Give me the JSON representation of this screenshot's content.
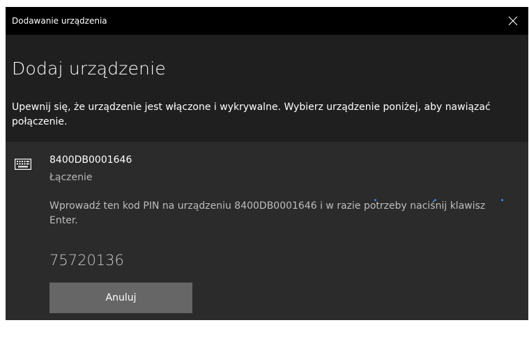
{
  "window": {
    "title": "Dodawanie urządzenia"
  },
  "header": {
    "heading": "Dodaj urządzenie",
    "description": "Upewnij się, że urządzenie jest włączone i wykrywalne. Wybierz urządzenie poniżej, aby nawiązać połączenie."
  },
  "device": {
    "icon": "keyboard-icon",
    "name": "8400DB0001646",
    "status": "Łączenie",
    "pin_message": "Wprowadź ten kod PIN na urządzeniu 8400DB0001646 i w razie potrzeby naciśnij klawisz Enter.",
    "pin": "75720136",
    "cancel_label": "Anuluj"
  },
  "colors": {
    "titlebar": "#000000",
    "background": "#1f1f1f",
    "panel": "#2b2b2b",
    "button": "#666666",
    "progress_dot": "#2f8cff"
  }
}
